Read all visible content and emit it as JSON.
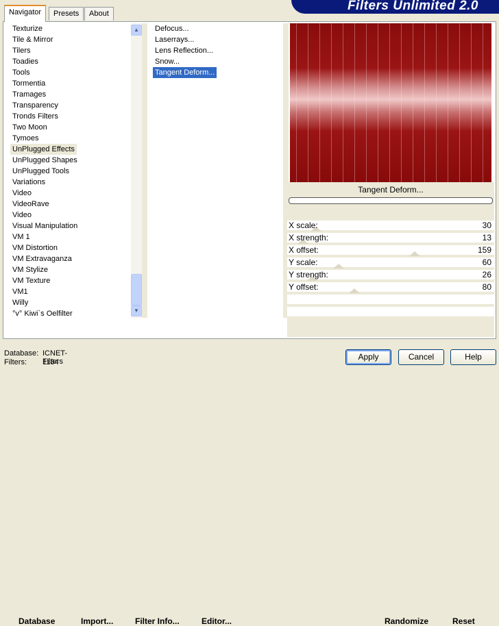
{
  "title": "Filters Unlimited 2.0",
  "tabs": [
    "Navigator",
    "Presets",
    "About"
  ],
  "categories": [
    "Texturize",
    "Tile & Mirror",
    "Tilers",
    "Toadies",
    "Tools",
    "Tormentia",
    "Tramages",
    "Transparency",
    "Tronds Filters",
    "Two Moon",
    "Tymoes",
    "UnPlugged Effects",
    "UnPlugged Shapes",
    "UnPlugged Tools",
    "Variations",
    "Video",
    "VideoRave",
    "Video",
    "Visual Manipulation",
    "VM 1",
    "VM Distortion",
    "VM Extravaganza",
    "VM Stylize",
    "VM Texture",
    "VM1",
    "Willy",
    "°v° Kiwi`s Oelfilter"
  ],
  "selected_category": "UnPlugged Effects",
  "filters": [
    "Defocus...",
    "Laserrays...",
    "Lens Reflection...",
    "Snow...",
    "Tangent Deform..."
  ],
  "selected_filter": "Tangent Deform...",
  "filter_name": "Tangent Deform...",
  "progress": 0,
  "params": [
    {
      "label": "X scale:",
      "value": 30
    },
    {
      "label": "X strength:",
      "value": 13
    },
    {
      "label": "X offset:",
      "value": 159
    },
    {
      "label": "Y scale:",
      "value": 60
    },
    {
      "label": "Y strength:",
      "value": 26
    },
    {
      "label": "Y offset:",
      "value": 80
    }
  ],
  "buttons": {
    "database": "Database",
    "import": "Import...",
    "filter_info": "Filter Info...",
    "editor": "Editor...",
    "randomize": "Randomize",
    "reset": "Reset",
    "apply": "Apply",
    "cancel": "Cancel",
    "help": "Help"
  },
  "status": {
    "database_label": "Database:",
    "database_value": "ICNET-Filters",
    "filters_label": "Filters:",
    "filters_value": "1184"
  }
}
